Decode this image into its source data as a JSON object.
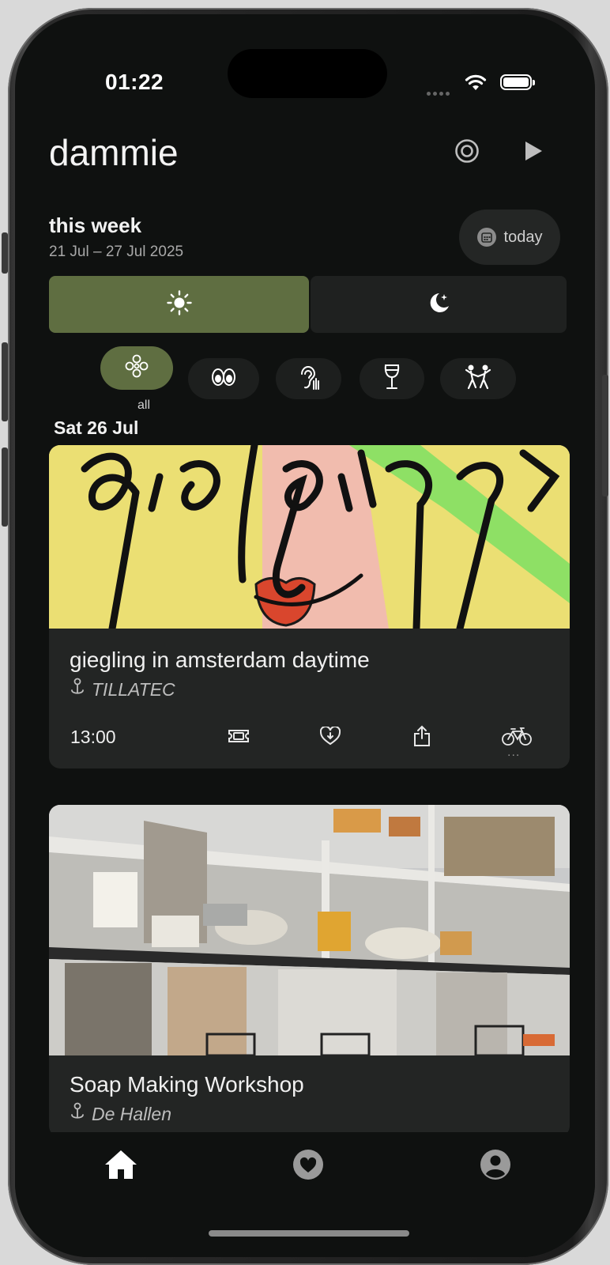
{
  "status_bar": {
    "time": "01:22"
  },
  "header": {
    "title": "dammie",
    "target_icon": "target-icon",
    "play_icon": "play-icon"
  },
  "week": {
    "title": "this week",
    "range": "21 Jul – 27 Jul 2025",
    "today_label": "today"
  },
  "toggle": {
    "day_icon": "sun-icon",
    "night_icon": "moon-stars-icon",
    "selected": "day"
  },
  "categories": {
    "selected": "all",
    "items": [
      {
        "icon": "flower-icon",
        "label": "all"
      },
      {
        "icon": "eyes-icon"
      },
      {
        "icon": "ear-icon"
      },
      {
        "icon": "wine-glass-icon"
      },
      {
        "icon": "dancers-icon"
      }
    ]
  },
  "date_header": "Sat 26 Jul",
  "events": [
    {
      "title": "giegling in amsterdam daytime",
      "venue": "TILLATEC",
      "time": "13:00",
      "actions": [
        "ticket-icon",
        "heart-plus-icon",
        "share-icon",
        "bicycle-icon"
      ],
      "extra": "..."
    },
    {
      "title": "Soap Making Workshop",
      "venue": "De Hallen"
    }
  ],
  "bottom_nav": [
    {
      "icon": "home-icon",
      "active": true
    },
    {
      "icon": "heart-icon",
      "active": false
    },
    {
      "icon": "profile-icon",
      "active": false
    }
  ],
  "colors": {
    "accent": "#5f6e41",
    "background": "#0f1110",
    "card": "#232524"
  }
}
